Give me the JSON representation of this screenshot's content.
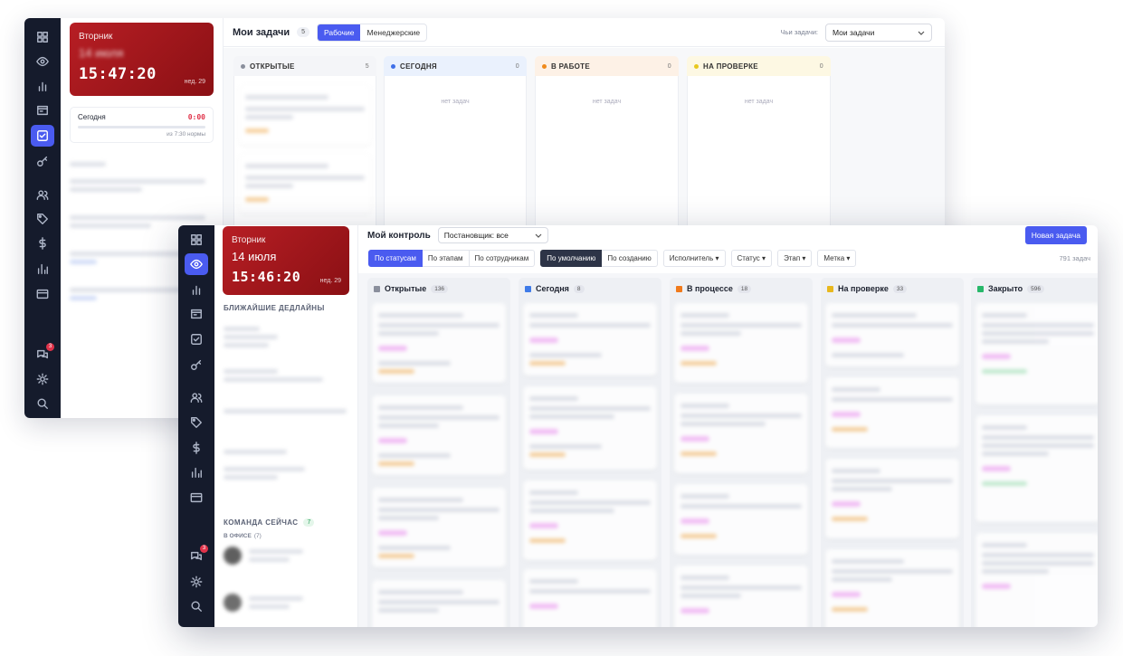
{
  "back": {
    "clock": {
      "weekday": "Вторник",
      "date": "14 июля",
      "time": "15:47:20",
      "week": "нед. 29"
    },
    "today": {
      "label": "Сегодня",
      "value": "0:00",
      "norm": "из 7:30 нормы"
    },
    "header": {
      "title": "Мои задачи",
      "count": "5",
      "tabs": [
        "Рабочие",
        "Менеджерские"
      ],
      "active_tab": 0,
      "owner_label": "Чьи задачи:",
      "owner_value": "Мои задачи"
    },
    "columns": [
      {
        "label": "ОТКРЫТЫЕ",
        "count": "5",
        "color": "#8a8f9c",
        "bg": "#f4f5f8"
      },
      {
        "label": "СЕГОДНЯ",
        "count": "0",
        "color": "#3f6fe8",
        "bg": "#eaf1fd",
        "empty": "нет задач"
      },
      {
        "label": "В РАБОТЕ",
        "count": "0",
        "color": "#f08a1c",
        "bg": "#fdf1e6",
        "empty": "нет задач"
      },
      {
        "label": "НА ПРОВЕРКЕ",
        "count": "0",
        "color": "#e8c81e",
        "bg": "#fdf8e3",
        "empty": "нет задач"
      }
    ]
  },
  "front": {
    "clock": {
      "weekday": "Вторник",
      "date": "14 июля",
      "time": "15:46:20",
      "week": "нед. 29"
    },
    "side": {
      "deadlines": "БЛИЖАЙШИЕ ДЕДЛАЙНЫ",
      "team": "КОМАНДА СЕЙЧАС",
      "team_count": "7",
      "office": "В ОФИСЕ",
      "office_count": "(7)"
    },
    "header": {
      "title": "Мой контроль",
      "setter": "Постановщик: все",
      "new_task": "Новая задача"
    },
    "filters": {
      "group": [
        "По статусам",
        "По этапам",
        "По сотрудникам"
      ],
      "sort": [
        "По умолчанию",
        "По созданию"
      ],
      "drops": [
        "Исполнитель",
        "Статус",
        "Этап",
        "Метка"
      ],
      "total": "791 задач"
    },
    "columns": [
      {
        "label": "Открытые",
        "count": "136",
        "color": "#8a8f9c"
      },
      {
        "label": "Сегодня",
        "count": "8",
        "color": "#3f7be8"
      },
      {
        "label": "В процессе",
        "count": "18",
        "color": "#f07a1c"
      },
      {
        "label": "На проверке",
        "count": "33",
        "color": "#e8b81e"
      },
      {
        "label": "Закрыто",
        "count": "596",
        "color": "#28b86a"
      }
    ]
  },
  "rail_icons": [
    "grid-icon",
    "eye-icon",
    "bar-chart-icon",
    "news-icon",
    "check-square-icon",
    "key-icon",
    "users-icon",
    "tag-icon",
    "dollar-icon",
    "stats-icon",
    "card-icon",
    "chat-icon",
    "settings-icon",
    "search-icon"
  ],
  "badge": "3"
}
